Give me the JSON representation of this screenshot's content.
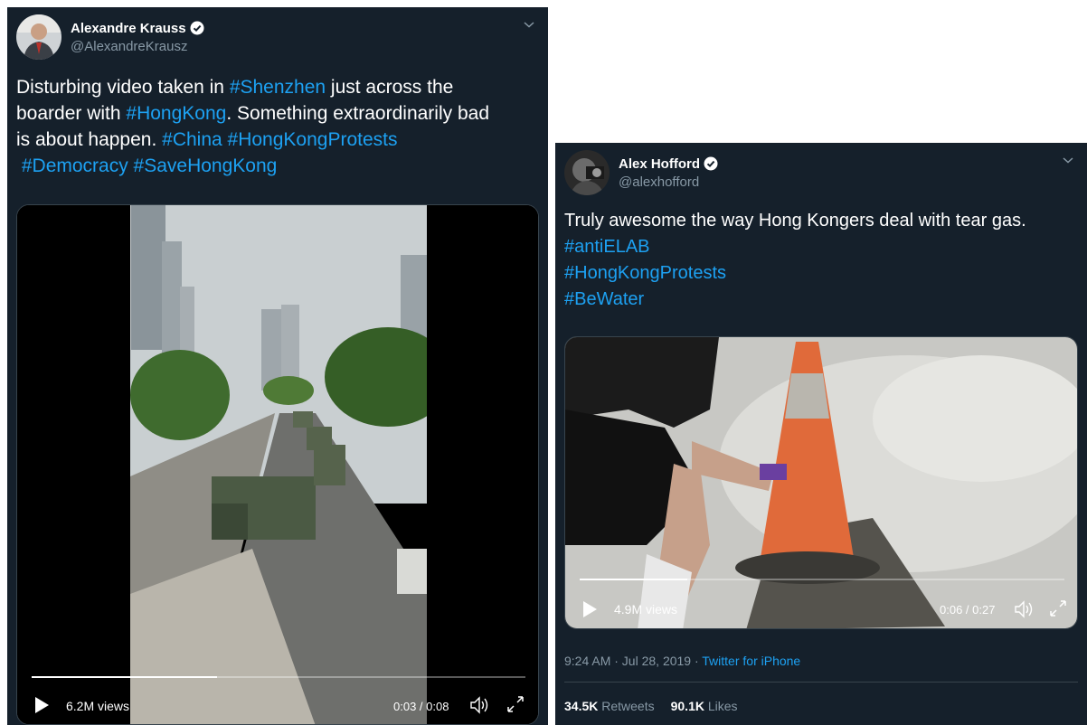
{
  "tweets": [
    {
      "display_name": "Alexandre Krauss",
      "handle": "@AlexandreKrausz",
      "text": [
        {
          "t": "Disturbing video taken in ",
          "tag": false
        },
        {
          "t": "#Shenzhen",
          "tag": true
        },
        {
          "t": " just across the\nboarder with ",
          "tag": false
        },
        {
          "t": "#HongKong",
          "tag": true
        },
        {
          "t": ". Something extraordinarily bad\nis about happen. ",
          "tag": false
        },
        {
          "t": "#China #HongKongProtests",
          "tag": true
        },
        {
          "t": "\n ",
          "tag": false
        },
        {
          "t": "#Democracy #SaveHongKong",
          "tag": true
        }
      ],
      "video": {
        "views": "6.2M views",
        "time": "0:03 / 0:08",
        "progress": 0.375
      }
    },
    {
      "display_name": "Alex Hofford",
      "handle": "@alexhofford",
      "text": [
        {
          "t": "Truly awesome the way Hong Kongers deal with tear gas.\n",
          "tag": false
        },
        {
          "t": "#antiELAB\n#HongKongProtests\n#BeWater",
          "tag": true
        }
      ],
      "video": {
        "views": "4.9M views",
        "time": "0:06 / 0:27",
        "progress": 0.222
      },
      "timestamp": "9:24 AM · Jul 28, 2019 · ",
      "source": "Twitter for iPhone",
      "retweets_count": "34.5K",
      "retweets_label": "Retweets",
      "likes_count": "90.1K",
      "likes_label": "Likes"
    }
  ],
  "colors": {
    "background": "#15202b",
    "link": "#1da1f2",
    "muted": "#8899a6"
  },
  "icons": [
    "verified-badge-icon",
    "chevron-down-icon",
    "play-icon",
    "volume-icon",
    "fullscreen-icon"
  ]
}
